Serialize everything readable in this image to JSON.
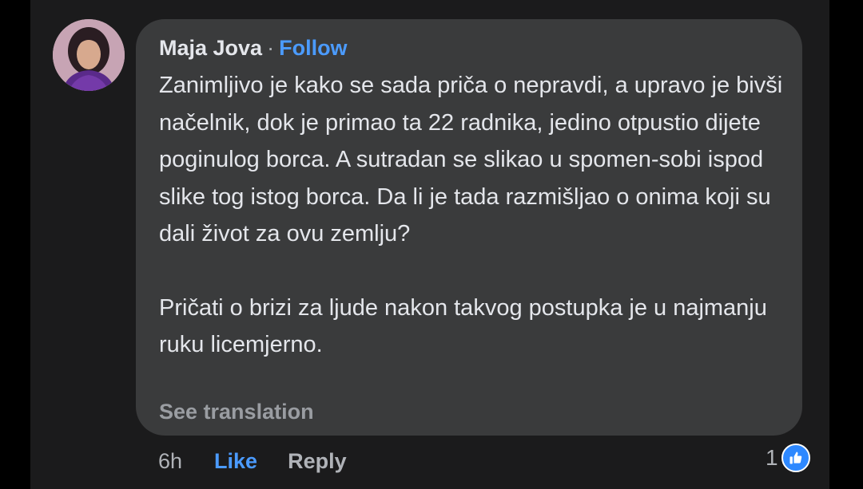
{
  "comment": {
    "author": "Maja Jova",
    "separator": "·",
    "follow_label": "Follow",
    "paragraphs": [
      "Zanimljivo je kako se sada priča o nepravdi, a upravo je bivši načelnik, dok je primao ta 22 radnika, jedino otpustio dijete poginulog borca. A sutradan se slikao u spomen-sobi ispod slike tog istog borca. Da li je tada razmišljao o onima koji su dali život za ovu zemlju?",
      "Pričati o brizi za ljude nakon takvog postupka je u najmanju ruku licemjerno."
    ],
    "see_translation_label": "See translation"
  },
  "actions": {
    "time": "6h",
    "like_label": "Like",
    "reply_label": "Reply",
    "reaction_count": "1",
    "reaction_icon": "thumbs-up-icon"
  },
  "colors": {
    "bubble": "#3a3b3c",
    "accent": "#4b9bff",
    "muted": "#b0b3b8",
    "text": "#e4e6eb"
  }
}
